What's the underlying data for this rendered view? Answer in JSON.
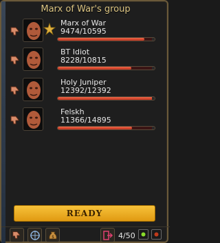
{
  "window": {
    "title": "Marx of War's group"
  },
  "members": [
    {
      "name": "Marx of War",
      "hp": "9474/10595",
      "hp_fraction": 0.894,
      "leader": true
    },
    {
      "name": "BT Idiot",
      "hp": "8228/10815",
      "hp_fraction": 0.761,
      "leader": false
    },
    {
      "name": "Holy Juniper",
      "hp": "12392/12392",
      "hp_fraction": 1.0,
      "leader": false
    },
    {
      "name": "Felskh",
      "hp": "11366/14895",
      "hp_fraction": 0.763,
      "leader": false
    }
  ],
  "ready_button": {
    "label": "READY"
  },
  "footer": {
    "group_count": "4/50"
  },
  "colors": {
    "title": "#dcc583",
    "ready": "#f0b02a",
    "hp_fill": "#e04a30"
  },
  "icons": [
    "thumbs-down-icon",
    "star-icon",
    "target-icon",
    "money-bag-icon",
    "leave-group-icon",
    "green-dot-icon",
    "red-dot-icon"
  ]
}
